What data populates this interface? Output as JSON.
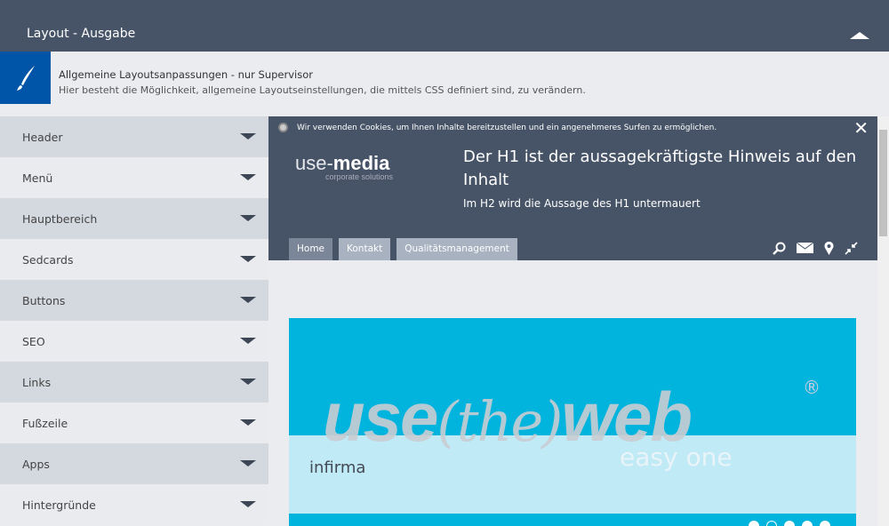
{
  "top": {
    "title": "Layout - Ausgabe",
    "collapse_icon": "chevron-up-icon"
  },
  "info": {
    "icon": "brush-icon",
    "heading": "Allgemeine Layoutsanpassungen - nur Supervisor",
    "text": "Hier besteht die Möglichkeit, allgemeine Layoutseinstellungen, die mittels CSS definiert sind, zu verändern.",
    "accent": "#0055a8"
  },
  "sidebar": {
    "items": [
      {
        "label": "Header"
      },
      {
        "label": "Menü"
      },
      {
        "label": "Hauptbereich"
      },
      {
        "label": "Sedcards"
      },
      {
        "label": "Buttons"
      },
      {
        "label": "SEO"
      },
      {
        "label": "Links"
      },
      {
        "label": "Fußzeile"
      },
      {
        "label": "Apps"
      },
      {
        "label": "Hintergründe"
      }
    ]
  },
  "preview": {
    "cookie": "Wir verwenden Cookies, um Ihnen Inhalte bereitzustellen und ein angenehmeres Surfen zu ermöglichen.",
    "close": "✕",
    "logo_a": "use-",
    "logo_b": "media",
    "logo_sub": "corporate solutions",
    "h1": "Der H1 ist der aussagekräftigste Hinweis auf den Inhalt",
    "h2": "Im H2 wird die Aussage des H1 untermauert",
    "nav": [
      {
        "label": "Home",
        "active": true
      },
      {
        "label": "Kontakt"
      },
      {
        "label": "Qualitätsmanagement"
      }
    ],
    "banner": {
      "w1": "use",
      "w2": "(the)",
      "w3": "web",
      "reg": "®",
      "sub": "easy one",
      "caption": "infirma",
      "slides": 5,
      "active_slide": 2,
      "color": "#00b4dd"
    }
  }
}
